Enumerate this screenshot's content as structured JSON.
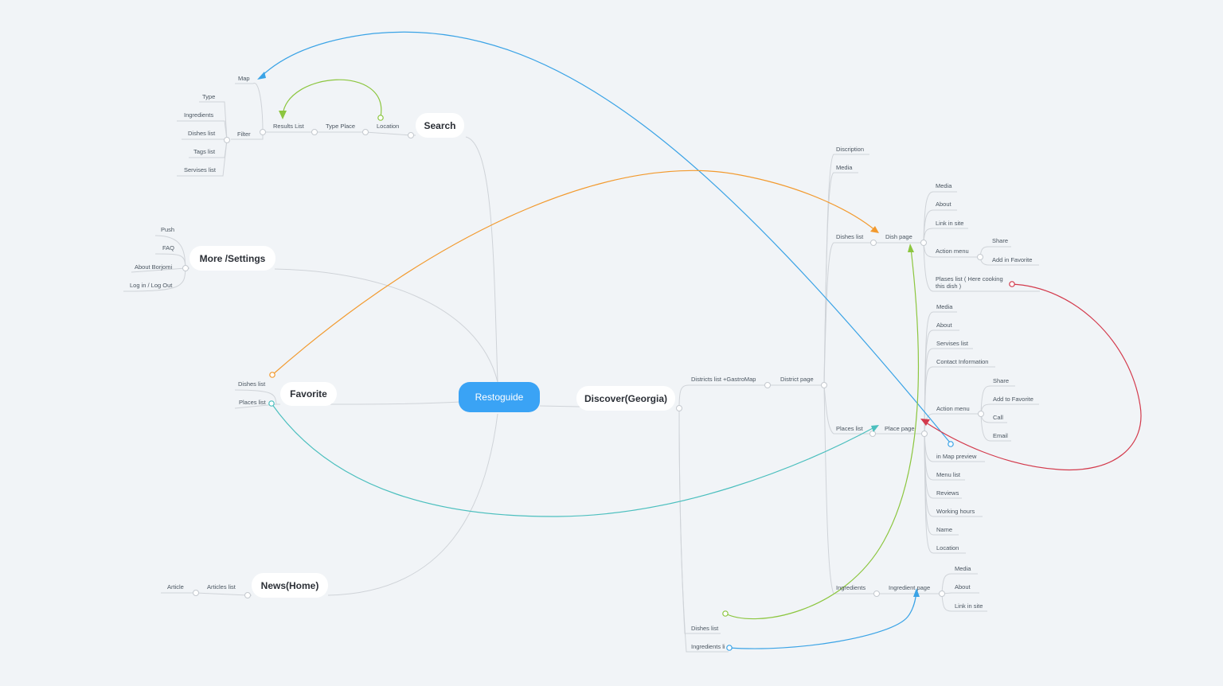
{
  "colors": {
    "background": "#f1f4f7",
    "root": "#3aa3f5",
    "branch_line": "#cfd3d8",
    "rel_blue": "#3aa3e6",
    "rel_green": "#8cc63f",
    "rel_orange": "#f29a2e",
    "rel_teal": "#4bbfbe",
    "rel_red": "#d33a4c"
  },
  "root": {
    "label": "Restoguide"
  },
  "topics": {
    "search": "Search",
    "settings": "More /Settings",
    "favorite": "Favorite",
    "news": "News(Home)",
    "discover": "Discover(Georgia)"
  },
  "search": {
    "location": "Location",
    "type_place": "Type Place",
    "results_list": "Results List",
    "map": "Map",
    "filter": "Filter",
    "filter_items": [
      "Type",
      "Ingredients",
      "Dishes list",
      "Tags list",
      "Servises list"
    ]
  },
  "settings": {
    "items": [
      "Push",
      "FAQ",
      "About Borjomi",
      "Log in / Log Out"
    ]
  },
  "favorite": {
    "items": [
      "Dishes list",
      "Places list"
    ]
  },
  "news": {
    "articles_list": "Articles list",
    "article": "Article"
  },
  "discover": {
    "districts_list": "Districts list +GastroMap",
    "district_page": "District page",
    "discription": "Discription",
    "media": "Media",
    "dishes_list": "Dishes list",
    "dish_page": "Dish page",
    "dish_items": [
      "Media",
      "About",
      "Link in site",
      "Action menu",
      "Plases list ( Here cooking",
      "this dish )"
    ],
    "dish_action_items": [
      "Share",
      "Add in Favorite"
    ],
    "places_list": "Places list",
    "place_page": "Place page",
    "place_items": [
      "Media",
      "About",
      "Servises list",
      "Contact Information",
      "Action menu",
      "in Map preview",
      "Menu list",
      "Reviews",
      "Working hours",
      "Name",
      "Location"
    ],
    "place_action_items": [
      "Share",
      "Add to Favorite",
      "Call",
      "Email"
    ],
    "ingredients": "Ingredients",
    "ingredient_page": "Ingredient page",
    "ingredient_items": [
      "Media",
      "About",
      "Link in site"
    ],
    "bottom_dishes_list": "Dishes list",
    "bottom_ingredients_list": "Ingredients li"
  }
}
